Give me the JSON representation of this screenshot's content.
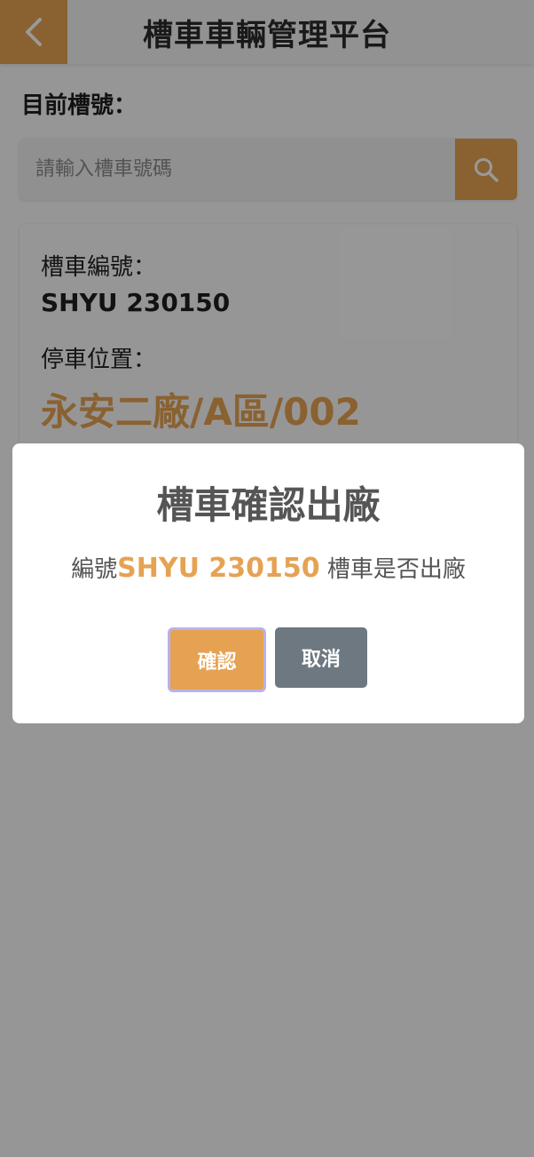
{
  "header": {
    "title": "槽車車輛管理平台",
    "back_icon": "chevron-left-icon"
  },
  "current_tank": {
    "label": "目前槽號："
  },
  "search": {
    "placeholder": "請輸入槽車號碼",
    "value": "",
    "icon": "search-icon"
  },
  "info": {
    "tank_label": "槽車編號：",
    "tank_value": "SHYU 230150",
    "location_label": "停車位置：",
    "location_value": "永安二廠/A區/002"
  },
  "modal": {
    "title": "槽車確認出廠",
    "message_prefix": "編號",
    "message_highlight": "SHYU 230150",
    "message_suffix": " 槽車是否出廠",
    "confirm_label": "確認",
    "cancel_label": "取消"
  },
  "colors": {
    "accent": "#e6a253",
    "cancel": "#6e7880",
    "overlay": "rgba(0,0,0,0.4)"
  }
}
